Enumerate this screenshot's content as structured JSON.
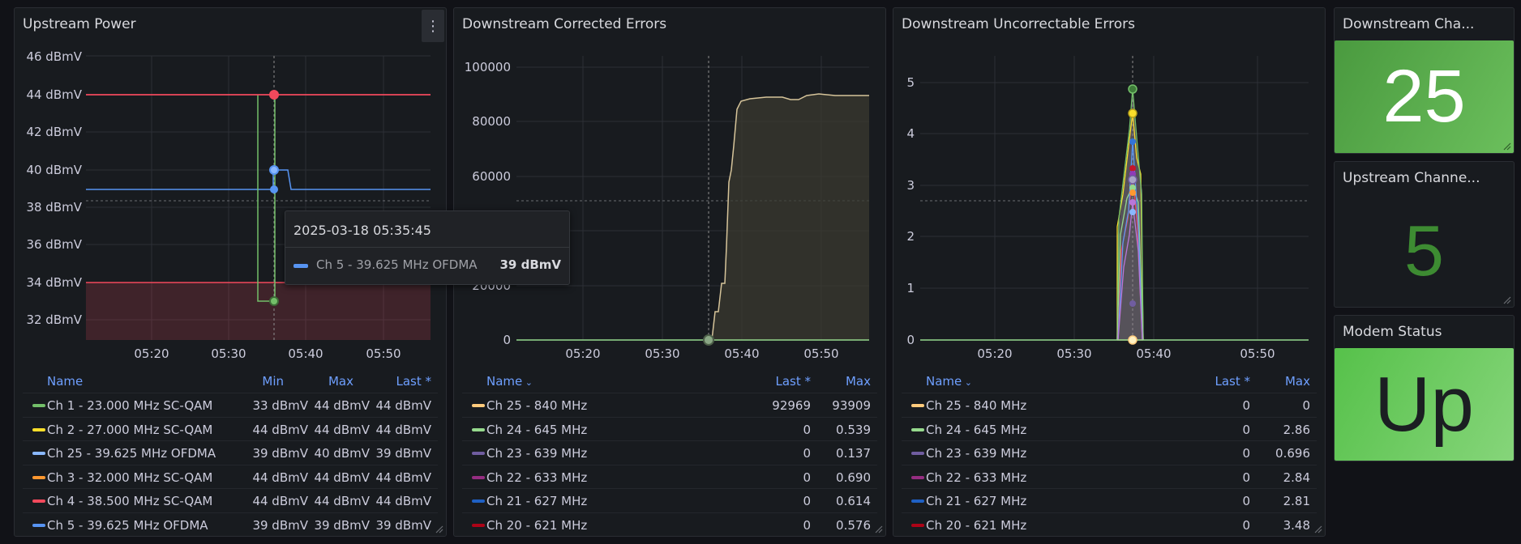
{
  "panels": {
    "upstream_power": {
      "title": "Upstream Power",
      "y_ticks": [
        "46 dBmV",
        "44 dBmV",
        "42 dBmV",
        "40 dBmV",
        "38 dBmV",
        "36 dBmV",
        "34 dBmV",
        "32 dBmV"
      ],
      "x_ticks": [
        "05:20",
        "05:30",
        "05:40",
        "05:50"
      ],
      "legend_headers": {
        "name": "Name",
        "min": "Min",
        "max": "Max",
        "last": "Last *"
      },
      "legend_rows": [
        {
          "name": "Ch 1 - 23.000 MHz SC-QAM",
          "color": "#73bf69",
          "min": "33 dBmV",
          "max": "44 dBmV",
          "last": "44 dBmV"
        },
        {
          "name": "Ch 2 - 27.000 MHz SC-QAM",
          "color": "#fade2a",
          "min": "44 dBmV",
          "max": "44 dBmV",
          "last": "44 dBmV"
        },
        {
          "name": "Ch 25 - 39.625 MHz OFDMA",
          "color": "#8ab8ff",
          "min": "39 dBmV",
          "max": "40 dBmV",
          "last": "39 dBmV"
        },
        {
          "name": "Ch 3 - 32.000 MHz SC-QAM",
          "color": "#ff9830",
          "min": "44 dBmV",
          "max": "44 dBmV",
          "last": "44 dBmV"
        },
        {
          "name": "Ch 4 - 38.500 MHz SC-QAM",
          "color": "#f2495c",
          "min": "44 dBmV",
          "max": "44 dBmV",
          "last": "44 dBmV"
        },
        {
          "name": "Ch 5 - 39.625 MHz OFDMA",
          "color": "#5794f2",
          "min": "39 dBmV",
          "max": "39 dBmV",
          "last": "39 dBmV"
        }
      ],
      "tooltip": {
        "time": "2025-03-18 05:35:45",
        "series": "Ch 5 - 39.625 MHz OFDMA",
        "value": "39 dBmV",
        "color": "#5794f2"
      }
    },
    "downstream_corrected": {
      "title": "Downstream Corrected Errors",
      "y_ticks": [
        "100000",
        "80000",
        "60000",
        "40000",
        "20000",
        "0"
      ],
      "x_ticks": [
        "05:20",
        "05:30",
        "05:40",
        "05:50"
      ],
      "legend_headers": {
        "name": "Name",
        "last": "Last *",
        "max": "Max"
      },
      "legend_rows": [
        {
          "name": "Ch 25 - 840 MHz",
          "color": "#ffcb7d",
          "last": "92969",
          "max": "93909"
        },
        {
          "name": "Ch 24 - 645 MHz",
          "color": "#96d98d",
          "last": "0",
          "max": "0.539"
        },
        {
          "name": "Ch 23 - 639 MHz",
          "color": "#705da0",
          "last": "0",
          "max": "0.137"
        },
        {
          "name": "Ch 22 - 633 MHz",
          "color": "#962d82",
          "last": "0",
          "max": "0.690"
        },
        {
          "name": "Ch 21 - 627 MHz",
          "color": "#1f60c4",
          "last": "0",
          "max": "0.614"
        },
        {
          "name": "Ch 20 - 621 MHz",
          "color": "#ad0317",
          "last": "0",
          "max": "0.576"
        }
      ]
    },
    "downstream_uncorrectable": {
      "title": "Downstream Uncorrectable Errors",
      "y_ticks": [
        "5",
        "4",
        "3",
        "2",
        "1",
        "0"
      ],
      "x_ticks": [
        "05:20",
        "05:30",
        "05:40",
        "05:50"
      ],
      "legend_headers": {
        "name": "Name",
        "last": "Last *",
        "max": "Max"
      },
      "legend_rows": [
        {
          "name": "Ch 25 - 840 MHz",
          "color": "#ffcb7d",
          "last": "0",
          "max": "0"
        },
        {
          "name": "Ch 24 - 645 MHz",
          "color": "#96d98d",
          "last": "0",
          "max": "2.86"
        },
        {
          "name": "Ch 23 - 639 MHz",
          "color": "#705da0",
          "last": "0",
          "max": "0.696"
        },
        {
          "name": "Ch 22 - 633 MHz",
          "color": "#962d82",
          "last": "0",
          "max": "2.84"
        },
        {
          "name": "Ch 21 - 627 MHz",
          "color": "#1f60c4",
          "last": "0",
          "max": "2.81"
        },
        {
          "name": "Ch 20 - 621 MHz",
          "color": "#ad0317",
          "last": "0",
          "max": "3.48"
        }
      ]
    },
    "downstream_channels": {
      "title": "Downstream Cha...",
      "value": "25"
    },
    "upstream_channels": {
      "title": "Upstream Channe...",
      "value": "5"
    },
    "modem_status": {
      "title": "Modem Status",
      "value": "Up"
    }
  },
  "colors": {
    "green": "#73bf69",
    "red": "#f2495c",
    "blue": "#5794f2",
    "panel_bg": "#181b1f",
    "stat_green": "#56a64b",
    "status_green": "#6ccf5e"
  }
}
